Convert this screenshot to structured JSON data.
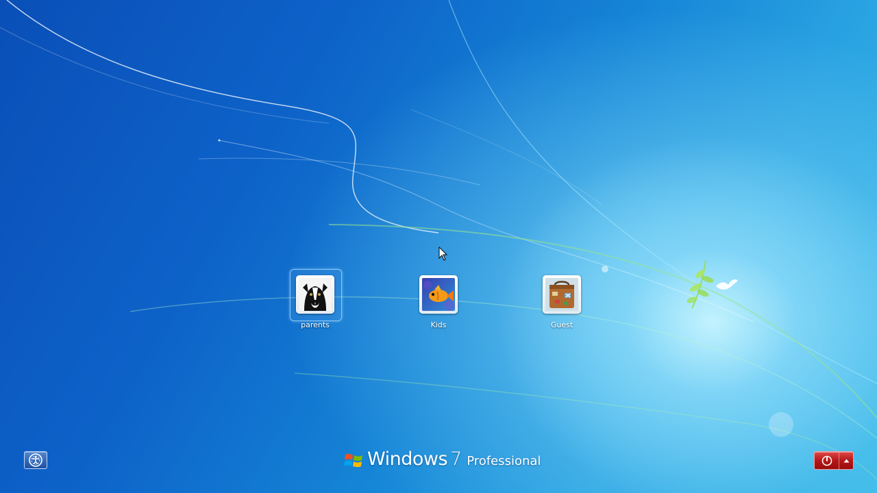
{
  "users": [
    {
      "name": "parents",
      "picture": "dog-picture",
      "selected": true
    },
    {
      "name": "Kids",
      "picture": "fish-picture",
      "selected": false
    },
    {
      "name": "Guest",
      "picture": "suitcase-picture",
      "selected": false
    }
  ],
  "branding": {
    "windows": "Windows",
    "version": "7",
    "edition": "Professional"
  },
  "buttons": {
    "ease_of_access_icon": "ease-of-access-icon",
    "power_icon": "power-icon",
    "power_options_icon": "up-arrow-icon"
  },
  "colors": {
    "power_red": "#b51818",
    "background_blue": "#1584d6"
  }
}
